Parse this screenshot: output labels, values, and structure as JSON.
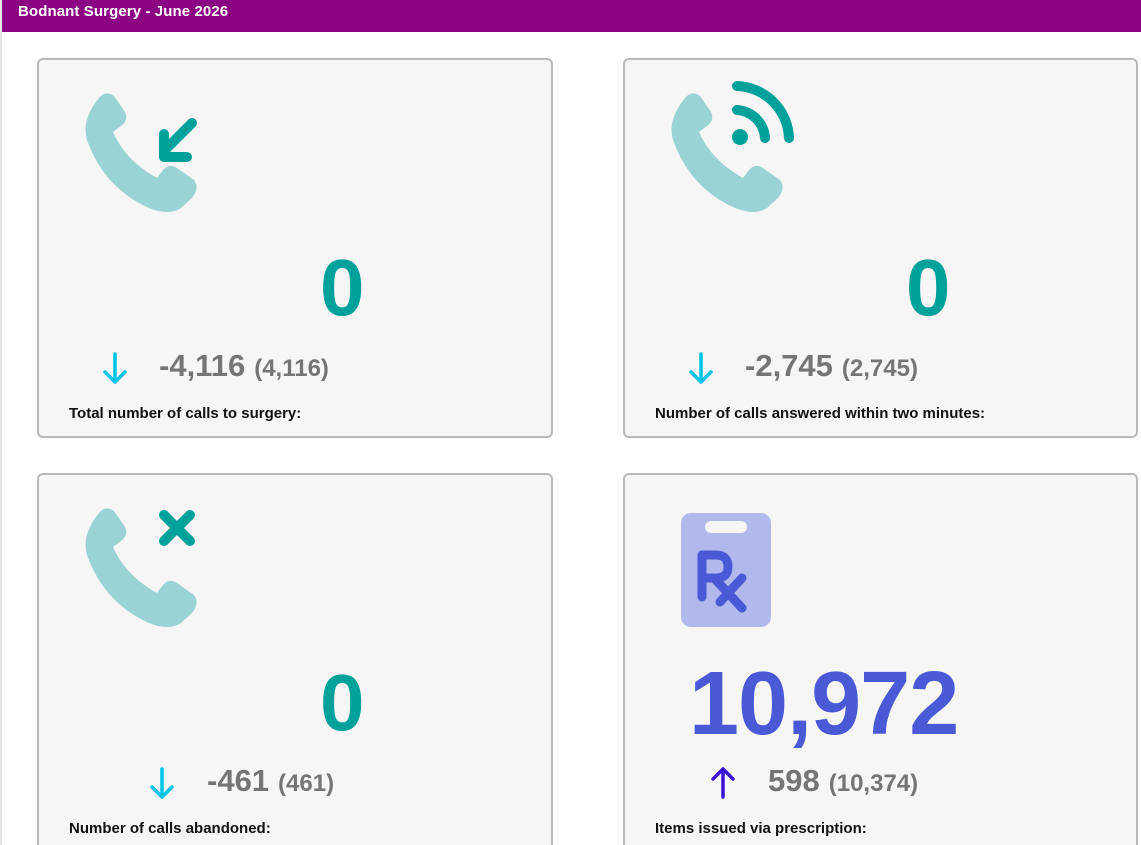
{
  "header": {
    "title": "Bodnant Surgery - June 2026"
  },
  "colors": {
    "header_bg": "#8b0282",
    "teal": "#00a19a",
    "teal_light": "#9ad3d5",
    "blue_metric": "#4a5ad6",
    "rx_light": "#b0b8ec",
    "arrow_down": "#00c3e6",
    "arrow_up": "#3a14d6",
    "change_grey": "#757575"
  },
  "cards": [
    {
      "icon": "phone-incoming-icon",
      "value": "0",
      "trend": "down",
      "change": "-4,116",
      "previous": "(4,116)",
      "label": "Total number of calls to surgery:"
    },
    {
      "icon": "phone-signal-icon",
      "value": "0",
      "trend": "down",
      "change": "-2,745",
      "previous": "(2,745)",
      "label": "Number of calls answered within two minutes:"
    },
    {
      "icon": "phone-missed-icon",
      "value": "0",
      "trend": "down",
      "change": "-461",
      "previous": "(461)",
      "label": "Number of calls abandoned:"
    },
    {
      "icon": "prescription-clipboard-icon",
      "value": "10,972",
      "trend": "up",
      "change": "598",
      "previous": "(10,374)",
      "label": "Items issued via prescription:"
    }
  ]
}
